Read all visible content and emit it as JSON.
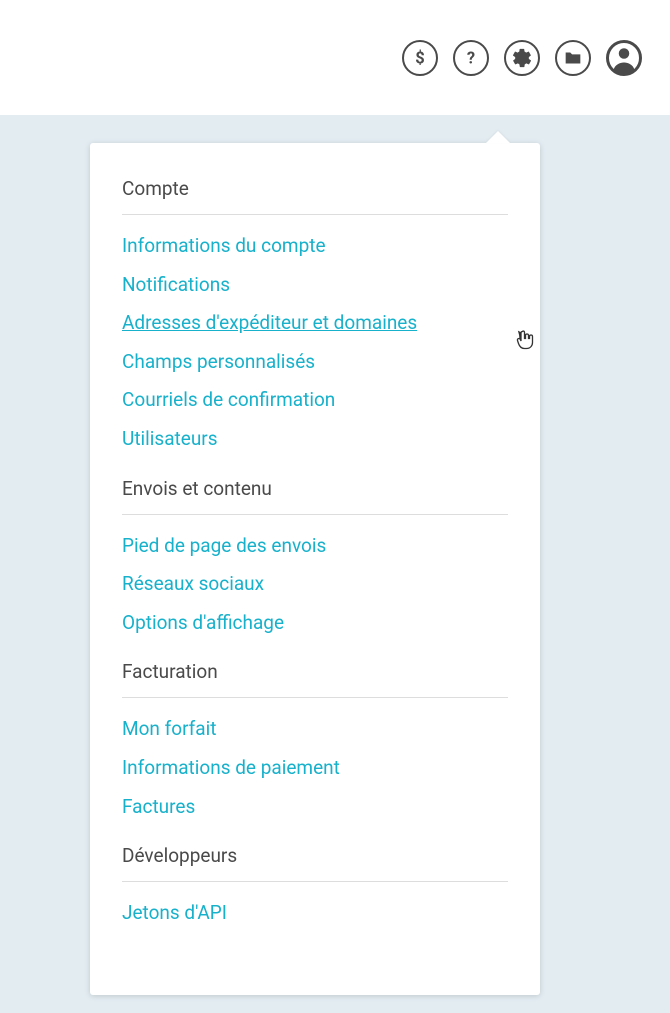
{
  "topbar": {
    "icons": [
      "dollar-icon",
      "help-icon",
      "gear-icon",
      "folder-icon",
      "avatar-icon"
    ]
  },
  "menu": {
    "sections": [
      {
        "title": "Compte",
        "items": [
          "Informations du compte",
          "Notifications",
          "Adresses d'expéditeur et domaines",
          "Champs personnalisés",
          "Courriels de confirmation",
          "Utilisateurs"
        ]
      },
      {
        "title": "Envois et contenu",
        "items": [
          "Pied de page des envois",
          "Réseaux sociaux",
          "Options d'affichage"
        ]
      },
      {
        "title": "Facturation",
        "items": [
          "Mon forfait",
          "Informations de paiement",
          "Factures"
        ]
      },
      {
        "title": "Développeurs",
        "items": [
          "Jetons d'API"
        ]
      }
    ]
  },
  "hovered_item": "Adresses d'expéditeur et domaines"
}
